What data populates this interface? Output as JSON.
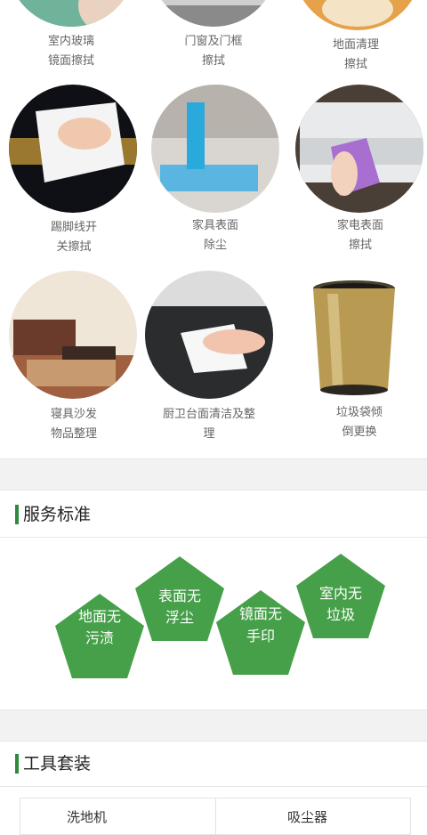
{
  "services": [
    {
      "line1": "室内玻璃",
      "line2": "镜面擦拭"
    },
    {
      "line1": "门窗及门框",
      "line2": "擦拭"
    },
    {
      "line1": "地面清理",
      "line2": "擦拭"
    },
    {
      "line1": "踢脚线开",
      "line2": "关擦拭"
    },
    {
      "line1": "家具表面",
      "line2": "除尘"
    },
    {
      "line1": "家电表面",
      "line2": "擦拭"
    },
    {
      "line1": "寝具沙发",
      "line2": "物品整理"
    },
    {
      "line1": "厨卫台面清洁及整",
      "line2": "理"
    },
    {
      "line1": "垃圾袋倾",
      "line2": "倒更换"
    }
  ],
  "standards": {
    "title": "服务标准",
    "items": [
      {
        "l1": "地面无",
        "l2": "污渍"
      },
      {
        "l1": "表面无",
        "l2": "浮尘"
      },
      {
        "l1": "镜面无",
        "l2": "手印"
      },
      {
        "l1": "室内无",
        "l2": "垃圾"
      }
    ]
  },
  "tools": {
    "title": "工具套装",
    "cells": [
      "洗地机",
      "吸尘器"
    ]
  },
  "colors": {
    "accent": "#2e8b3e",
    "pentagon": "#46a049"
  }
}
